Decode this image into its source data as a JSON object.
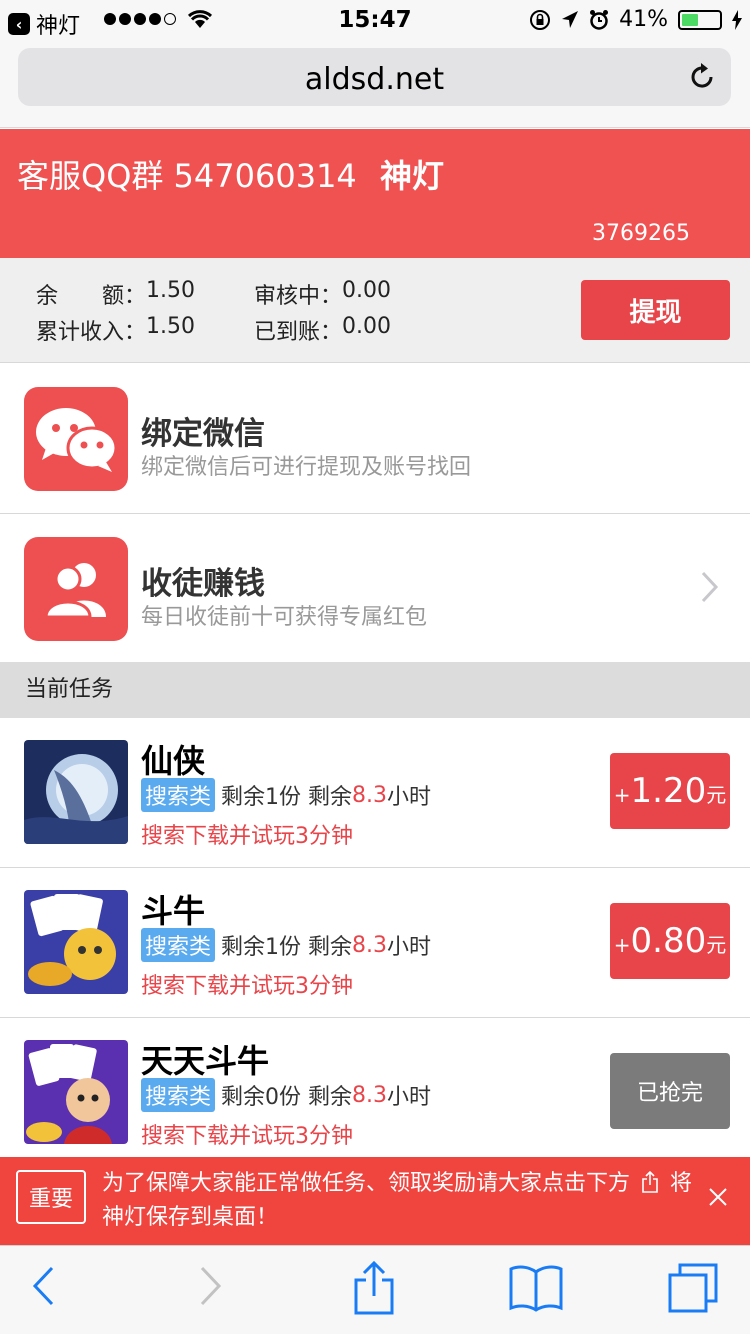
{
  "status_bar": {
    "app_back": "神灯",
    "time": "15:47",
    "battery": "41%"
  },
  "browser": {
    "url": "aldsd.net"
  },
  "header": {
    "qq_group": "客服QQ群 547060314",
    "brand": "神灯",
    "user_id": "3769265"
  },
  "balance": {
    "balance_label": "余　　额：",
    "balance_value": "1.50",
    "reviewing_label": "审核中：",
    "reviewing_value": "0.00",
    "total_label": "累计收入：",
    "total_value": "1.50",
    "arrived_label": "已到账：",
    "arrived_value": "0.00",
    "withdraw_label": "提现"
  },
  "features": [
    {
      "title": "绑定微信",
      "subtitle": "绑定微信后可进行提现及账号找回",
      "icon": "wechat-icon"
    },
    {
      "title": "收徒赚钱",
      "subtitle": "每日收徒前十可获得专属红包",
      "icon": "users-icon"
    }
  ],
  "section_title": "当前任务",
  "tasks": [
    {
      "name": "仙侠",
      "tag": "搜索类",
      "remaining": "剩余1份",
      "time_prefix": "剩余",
      "time_value": "8.3",
      "time_unit": "小时",
      "desc": "搜索下载并试玩3分钟",
      "plus": "+",
      "amount": "1.20",
      "unit": "元"
    },
    {
      "name": "斗牛",
      "tag": "搜索类",
      "remaining": "剩余1份",
      "time_prefix": "剩余",
      "time_value": "8.3",
      "time_unit": "小时",
      "desc": "搜索下载并试玩3分钟",
      "plus": "+",
      "amount": "0.80",
      "unit": "元"
    },
    {
      "name": "天天斗牛",
      "tag": "搜索类",
      "remaining": "剩余0份",
      "time_prefix": "剩余",
      "time_value": "8.3",
      "time_unit": "小时",
      "desc": "搜索下载并试玩3分钟",
      "status": "已抢完"
    }
  ],
  "notice": {
    "badge": "重要",
    "text_1": "为了保障大家能正常做任务、领取奖励请大家点击下方",
    "text_2": "将神灯保存到桌面！"
  },
  "colors": {
    "brand_red": "#f05252",
    "button_red": "#e8454a",
    "tag_blue": "#5aaaf0",
    "done_gray": "#7b7b7b"
  }
}
